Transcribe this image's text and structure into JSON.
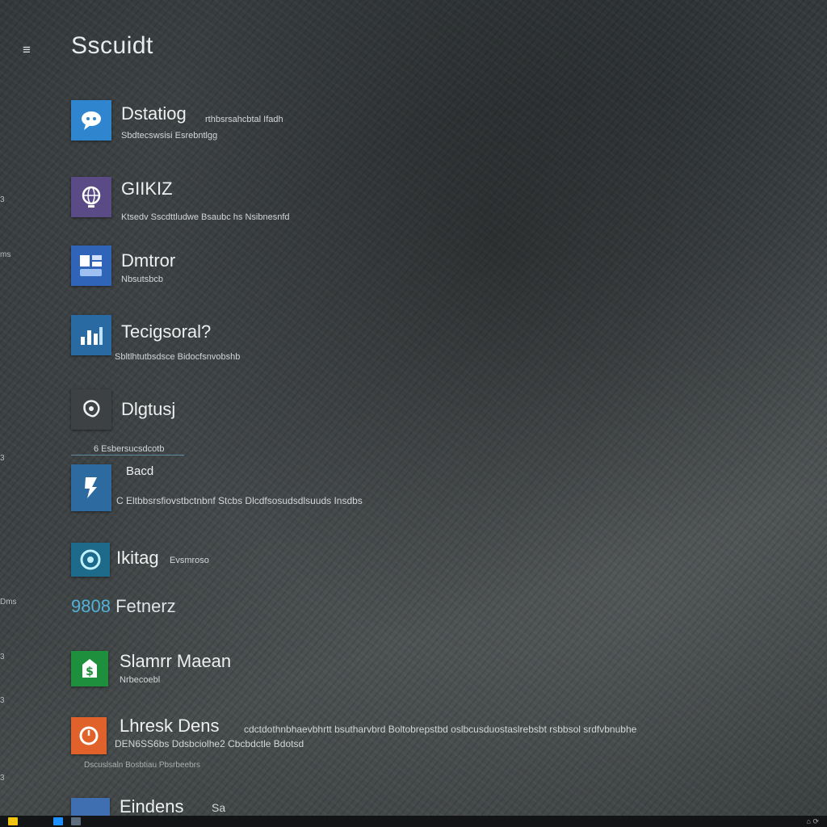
{
  "header": {
    "menu_icon": "hamburger-icon",
    "title": "Sscuidt"
  },
  "edge_labels": [
    "3",
    "ms",
    "3",
    "Dms",
    "3",
    "3",
    "3"
  ],
  "apps": [
    {
      "name": "Dstatiog",
      "detail": "rthbsrsahcbtal Ifadh",
      "sub": "Sbdtecswsisi Esrebntlgg",
      "tile_color": "#2f86cf",
      "icon": "chat-icon"
    },
    {
      "name": "GIIKIZ",
      "detail": "",
      "sub": "Ktsedv Sscdttludwe Bsaubc hs Nsibnesnfd",
      "tile_color": "#5a4a86",
      "icon": "globe-icon"
    },
    {
      "name": "Dmtror",
      "detail": "",
      "sub": "Nbsutsbcb",
      "tile_color": "#2f64b9",
      "icon": "document-icon"
    },
    {
      "name": "Tecigsoral?",
      "detail": "",
      "sub": "Sbltlhtutbsdsce Bidocfsnvobshb",
      "tile_color": "#2a6aa3",
      "icon": "chart-icon"
    },
    {
      "name": "Dlgtusj",
      "detail": "",
      "sub": "",
      "tile_color": "#3e4143",
      "icon": "puzzle-icon"
    },
    {
      "name": "Bacd",
      "detail": "",
      "sub": "C Eltbbsrsfiovstbctnbnf Stcbs Dlcdfsosudsdlsuuds Insdbs",
      "tile_color": "#2c6aa0",
      "icon": "tool-icon"
    },
    {
      "name": "Ikitag",
      "detail": "Evsmroso",
      "sub": "",
      "tile_color": "#1d6a8a",
      "icon": "circle-icon"
    }
  ],
  "divider_label": "6 Esbersucsdcotb",
  "section": {
    "number": "9808",
    "label": "Fetnerz"
  },
  "apps2": [
    {
      "name": "Slamrr Maean",
      "detail": "",
      "sub": "Nrbecoebl",
      "tile_color": "#1e8f3c",
      "icon": "dollar-icon"
    },
    {
      "name": "Lhresk Dens",
      "detail": "cdctdothnbhaevbhrtt bsutharvbrd Boltobrepstbd oslbcusduostaslrebsbt rsbbsol srdfvbnubhe",
      "sub": "DEN6SS6bs Ddsbciolhe2 Cbcbdctle Bdotsd",
      "sub2": "Dscuslsaln  Bosbtiau  Pbsrbeebrs",
      "tile_color": "#e0612a",
      "icon": "calendar-icon"
    },
    {
      "name": "Eindens",
      "detail": "Sa",
      "sub": "",
      "tile_color": "#3f6fb0",
      "icon": "folder-icon"
    }
  ],
  "taskbar": {
    "icons": [
      "start-icon",
      "edge-icon",
      "file-explorer-icon"
    ],
    "tray": "⌂ ⟳"
  }
}
